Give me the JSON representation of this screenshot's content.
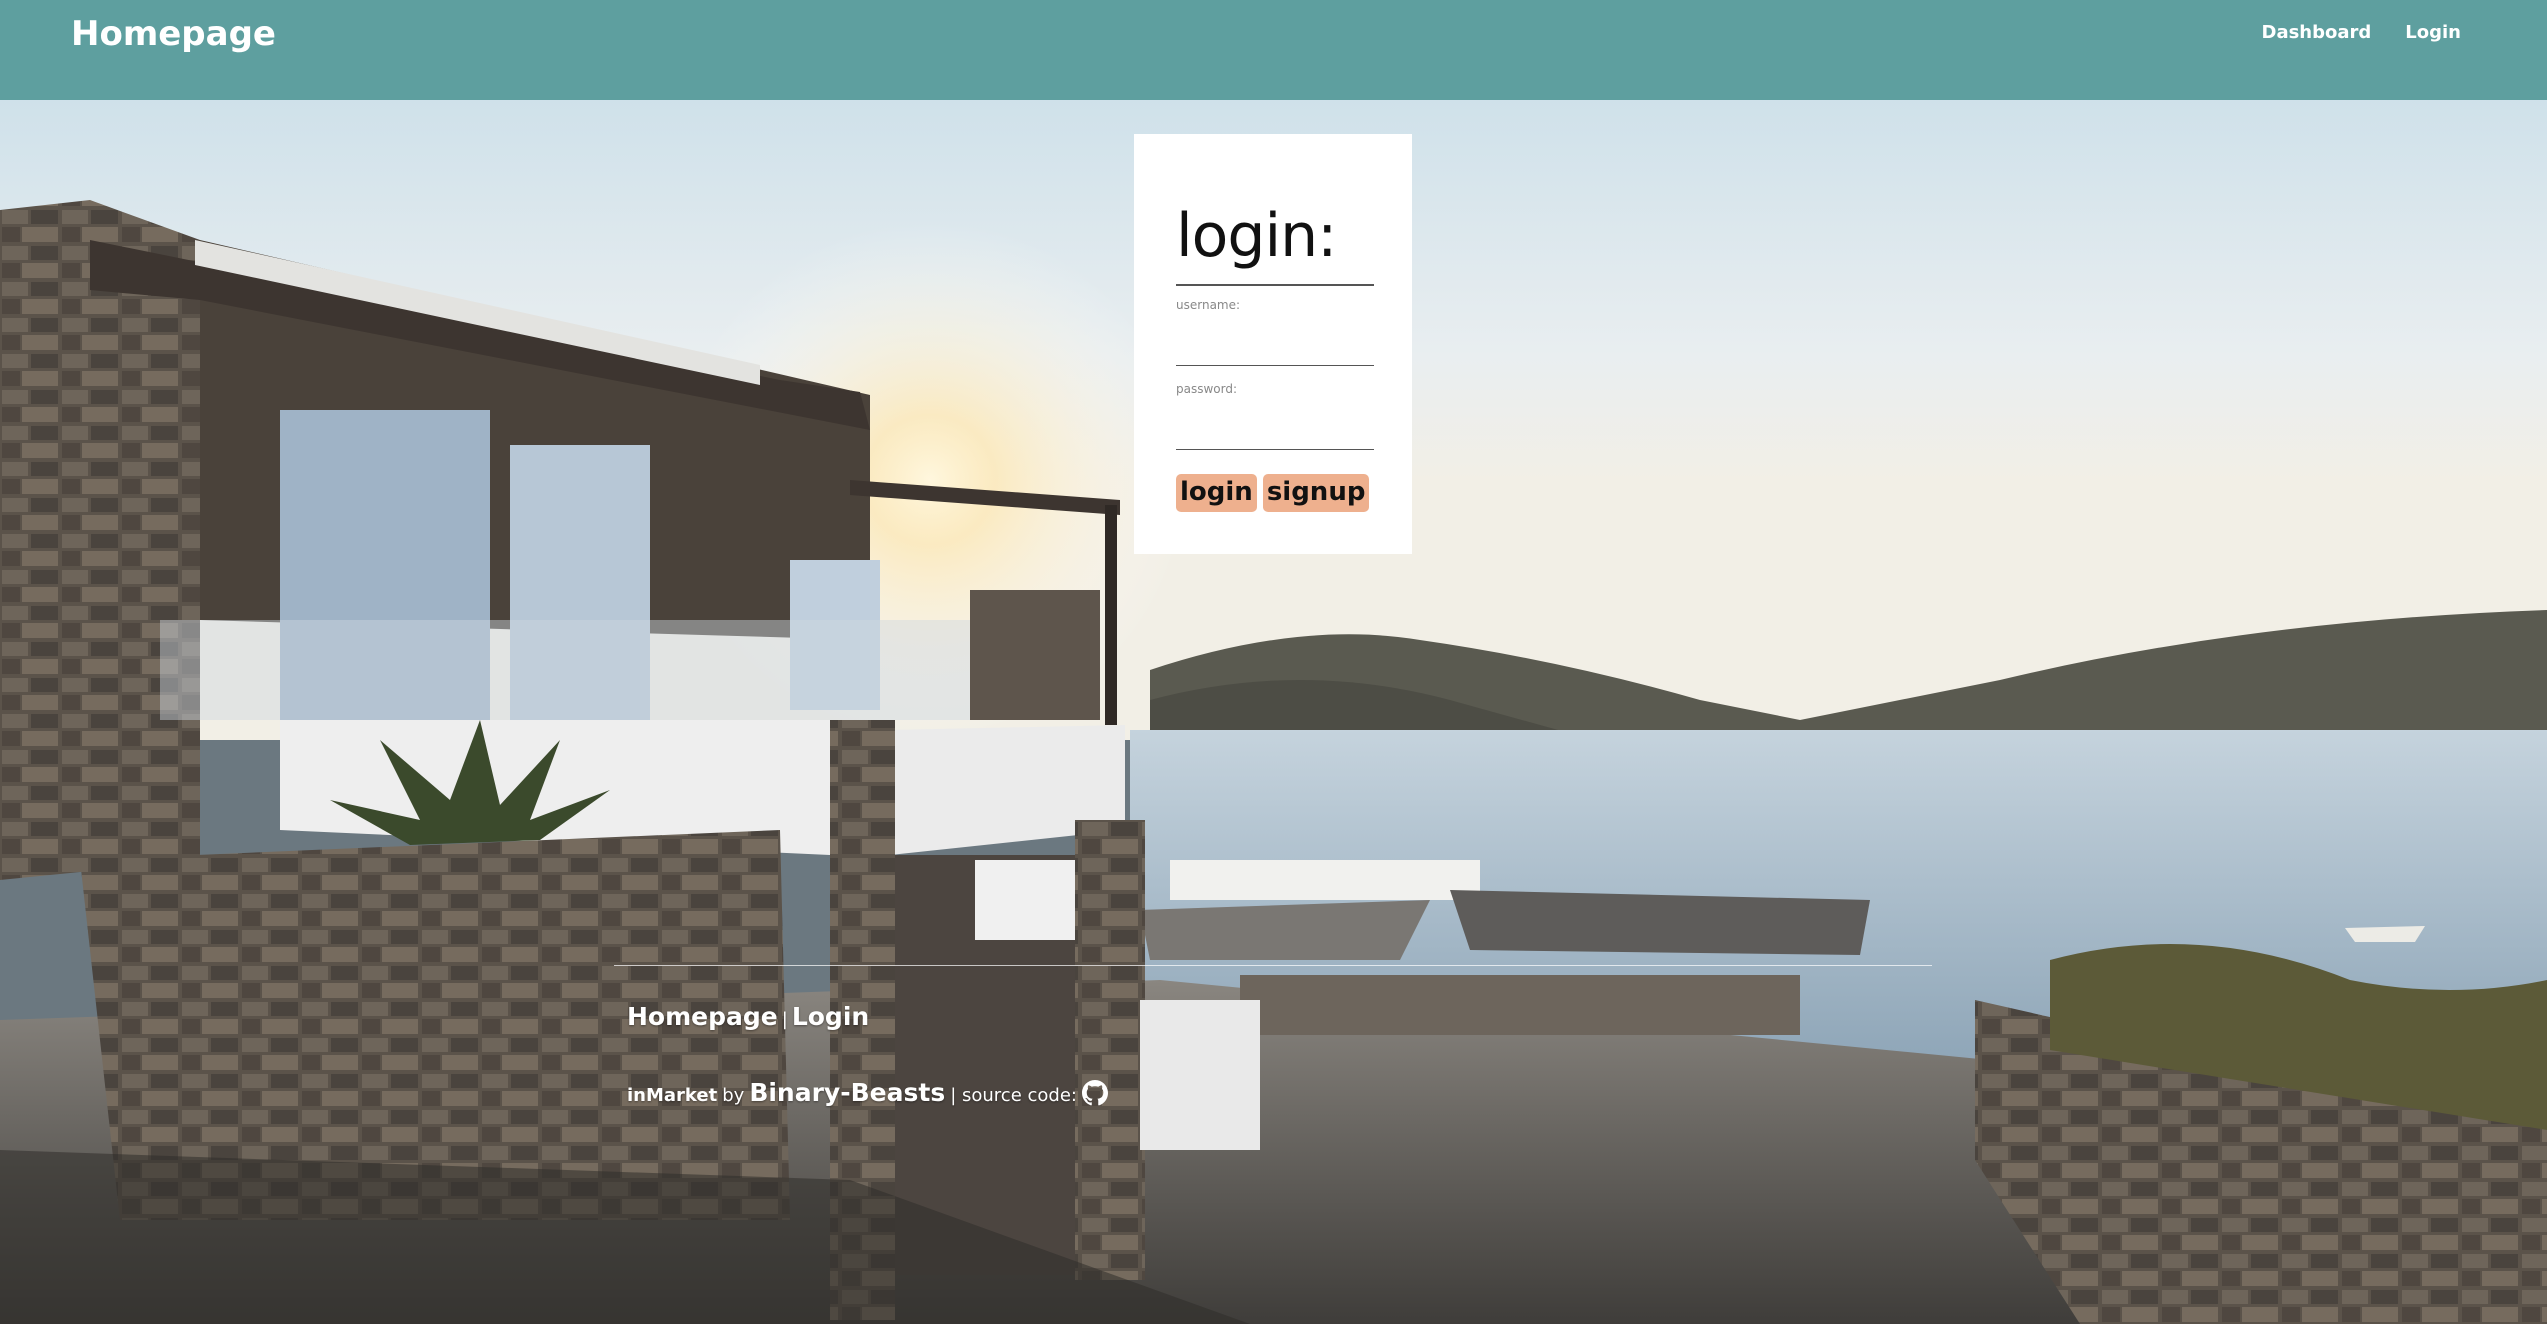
{
  "navbar": {
    "brand": "Homepage",
    "links": [
      "Dashboard",
      "Login"
    ],
    "color": "#5e9f9f"
  },
  "login": {
    "title": "login:",
    "username_label": "username:",
    "username_value": "",
    "password_label": "password:",
    "password_value": "",
    "login_button": "login",
    "signup_button": "signup",
    "button_color": "#eeb08e"
  },
  "footer": {
    "links": [
      "Homepage",
      "Login"
    ],
    "separator": "|",
    "app_name": "inMarket",
    "by": "by",
    "team": "Binary-Beasts",
    "source_prefix": "| source code:",
    "source_icon": "github-icon"
  }
}
